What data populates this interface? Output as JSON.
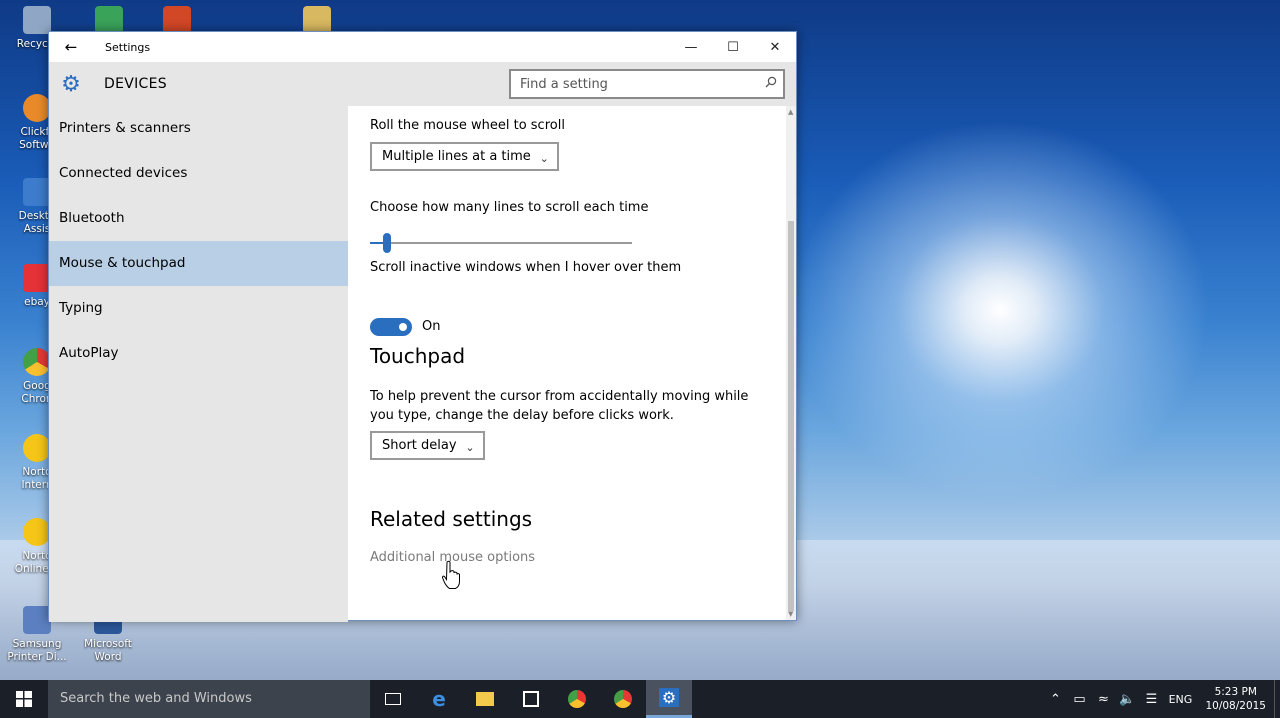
{
  "desktop": {
    "icons": [
      {
        "label": "Recycle",
        "color": "#8fa7c4"
      },
      {
        "label": "Clickfr Softwa",
        "color": "#e88a2a"
      },
      {
        "label": "Deskto Assis",
        "color": "#3d7ccc"
      },
      {
        "label": "ebay",
        "color": "#e53238"
      },
      {
        "label": "Goog Chron",
        "color": "#4caf50"
      },
      {
        "label": "Norto Intern",
        "color": "#f5c518"
      },
      {
        "label": "Norto Online B",
        "color": "#f5c518"
      },
      {
        "label": "Samsung Printer Di...",
        "color": "#5b7fc0"
      },
      {
        "label": "Microsoft Word",
        "color": "#2b579a"
      }
    ]
  },
  "window": {
    "title": "Settings",
    "section_title": "DEVICES",
    "search_placeholder": "Find a setting"
  },
  "sidebar": {
    "items": [
      {
        "label": "Printers & scanners",
        "active": false
      },
      {
        "label": "Connected devices",
        "active": false
      },
      {
        "label": "Bluetooth",
        "active": false
      },
      {
        "label": "Mouse & touchpad",
        "active": true
      },
      {
        "label": "Typing",
        "active": false
      },
      {
        "label": "AutoPlay",
        "active": false
      }
    ]
  },
  "content": {
    "scroll_label": "Roll the mouse wheel to scroll",
    "scroll_value": "Multiple lines at a time",
    "lines_label": "Choose how many lines to scroll each time",
    "lines_slider_fraction": 0.05,
    "inactive_label": "Scroll inactive windows when I hover over them",
    "inactive_state": "On",
    "touchpad_heading": "Touchpad",
    "touchpad_desc": "To help prevent the cursor from accidentally moving while you type, change the delay before clicks work.",
    "touchpad_delay": "Short delay",
    "related_heading": "Related settings",
    "related_link": "Additional mouse options"
  },
  "taskbar": {
    "search_text": "Search the web and Windows",
    "lang": "ENG",
    "time": "5:23 PM",
    "date": "10/08/2015"
  },
  "colors": {
    "accent": "#2a6ebf",
    "selected": "#b8cfe6",
    "sidebar_bg": "#e6e6e6"
  }
}
